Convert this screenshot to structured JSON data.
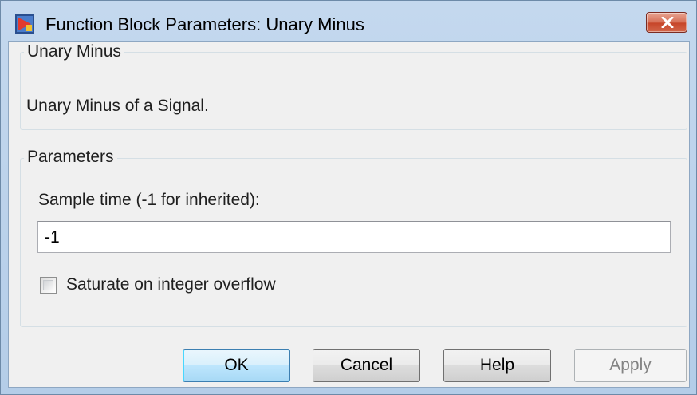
{
  "window": {
    "title": "Function Block Parameters: Unary Minus",
    "icon": "simulink-block-icon",
    "close_icon": "close-icon"
  },
  "description_group": {
    "title": "Unary Minus",
    "text": "Unary Minus of a Signal."
  },
  "parameters_group": {
    "title": "Parameters",
    "sample_time_label": "Sample time (-1 for inherited):",
    "sample_time_value": "-1",
    "saturate_label": "Saturate on integer overflow",
    "saturate_checked": false
  },
  "buttons": {
    "ok": "OK",
    "cancel": "Cancel",
    "help": "Help",
    "apply": "Apply"
  }
}
